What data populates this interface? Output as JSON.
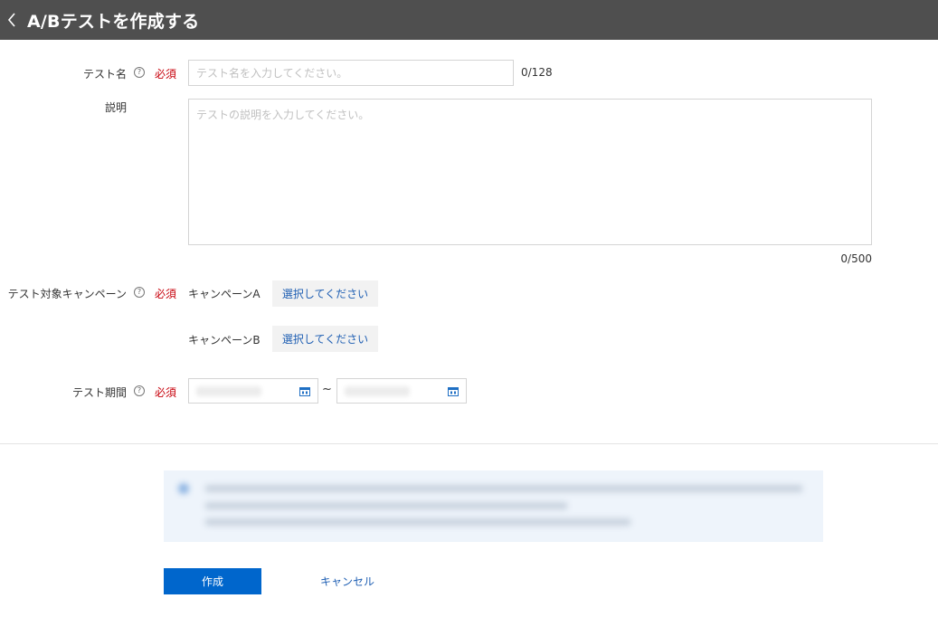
{
  "header": {
    "title": "A/Bテストを作成する"
  },
  "form": {
    "test_name": {
      "label": "テスト名",
      "help": "?",
      "required": "必須",
      "placeholder": "テスト名を入力してください。",
      "value": "",
      "counter": "0/128"
    },
    "description": {
      "label": "説明",
      "placeholder": "テストの説明を入力してください。",
      "value": "",
      "counter": "0/500"
    },
    "campaigns": {
      "label": "テスト対象キャンペーン",
      "help": "?",
      "required": "必須",
      "campaign_a": {
        "label": "キャンペーンA",
        "button": "選択してください"
      },
      "campaign_b": {
        "label": "キャンペーンB",
        "button": "選択してください"
      }
    },
    "period": {
      "label": "テスト期間",
      "help": "?",
      "required": "必須",
      "separator": "~"
    }
  },
  "actions": {
    "create": "作成",
    "cancel": "キャンセル"
  },
  "colors": {
    "header_bg": "#4f4f4f",
    "required": "#c7000b",
    "primary": "#0066cc",
    "link": "#1f5fb3",
    "notice_bg": "#eef4fb"
  },
  "icons": {
    "back": "chevron-left-icon",
    "help": "question-circle-icon",
    "calendar": "calendar-icon",
    "info": "info-icon"
  }
}
